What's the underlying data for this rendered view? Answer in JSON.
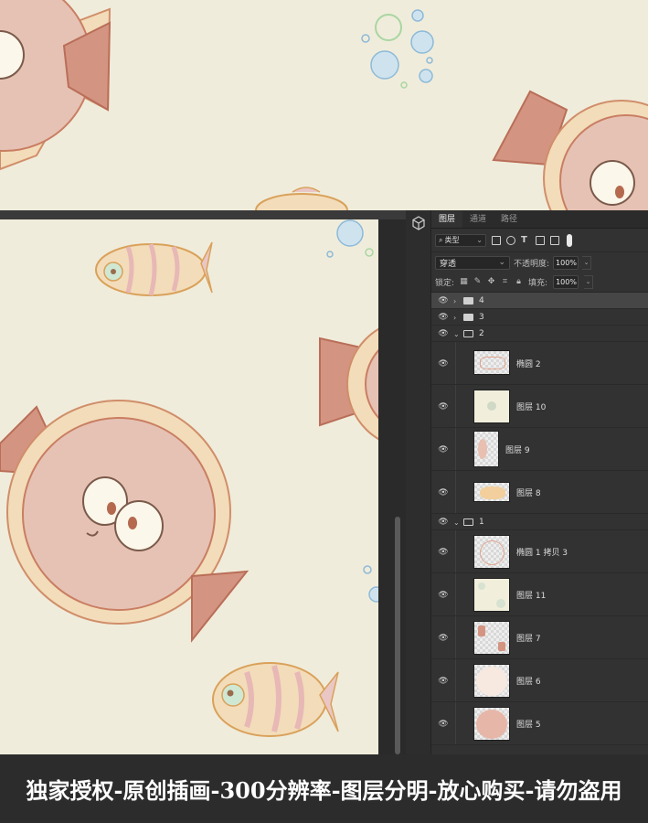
{
  "panel": {
    "tabs": [
      "图层",
      "通道",
      "路径"
    ],
    "filter": {
      "kind_label": "类型",
      "kind_icon": "search-icon"
    },
    "blend": {
      "mode": "穿透",
      "opacity_label": "不透明度:",
      "opacity_value": "100%"
    },
    "lock": {
      "label": "锁定:",
      "fill_label": "填充:",
      "fill_value": "100%"
    }
  },
  "layers": {
    "g4": "4",
    "g3": "3",
    "g2": "2",
    "l_ellipse2": "椭圆 2",
    "l_10": "图层 10",
    "l_9": "图层 9",
    "l_8": "图层 8",
    "g1": "1",
    "l_ellipse1copy3": "椭圆 1 拷贝 3",
    "l_11": "图层 11",
    "l_7": "图层 7",
    "l_6": "图层 6",
    "l_5": "图层 5"
  },
  "banner": {
    "text": "独家授权-原创插画-300分辨率-图层分明-放心购买-请勿盗用"
  },
  "colors": {
    "background": "#f0ecdb",
    "pufferfish": "#e6c2b5",
    "fin": "#d49482",
    "outline": "#c97e62",
    "panel": "#323232",
    "banner": "#2c2c2c"
  }
}
